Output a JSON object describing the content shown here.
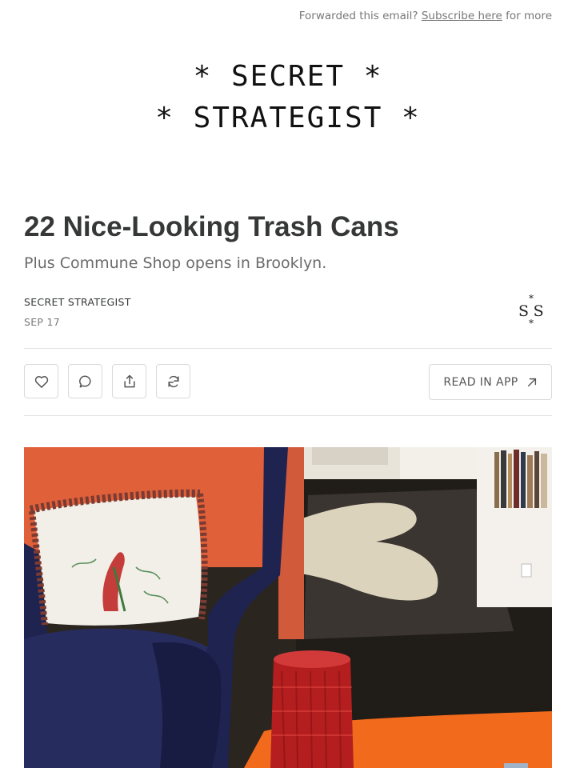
{
  "preheader": {
    "text": "Forwarded this email?",
    "link": "Subscribe here",
    "suffix": "for more"
  },
  "masthead": {
    "line1": "* SECRET *",
    "line2": "* STRATEGIST *"
  },
  "post": {
    "title": "22 Nice-Looking Trash Cans",
    "subtitle": "Plus Commune Shop opens in Brooklyn.",
    "author": "SECRET STRATEGIST",
    "date": "SEP 17"
  },
  "publication_logo": {
    "letters": "SS",
    "star": "*"
  },
  "actions": {
    "like_icon": "heart-icon",
    "comment_icon": "comment-icon",
    "share_icon": "share-icon",
    "restack_icon": "restack-icon",
    "read_in_app_label": "READ IN APP",
    "read_in_app_icon": "arrow-up-right-icon"
  },
  "hero_image": {
    "description_icon": "interior-photo"
  },
  "colors": {
    "text": "#363737",
    "muted": "#777777",
    "border": "#d9d9d9",
    "divider": "#e3e3e3"
  }
}
